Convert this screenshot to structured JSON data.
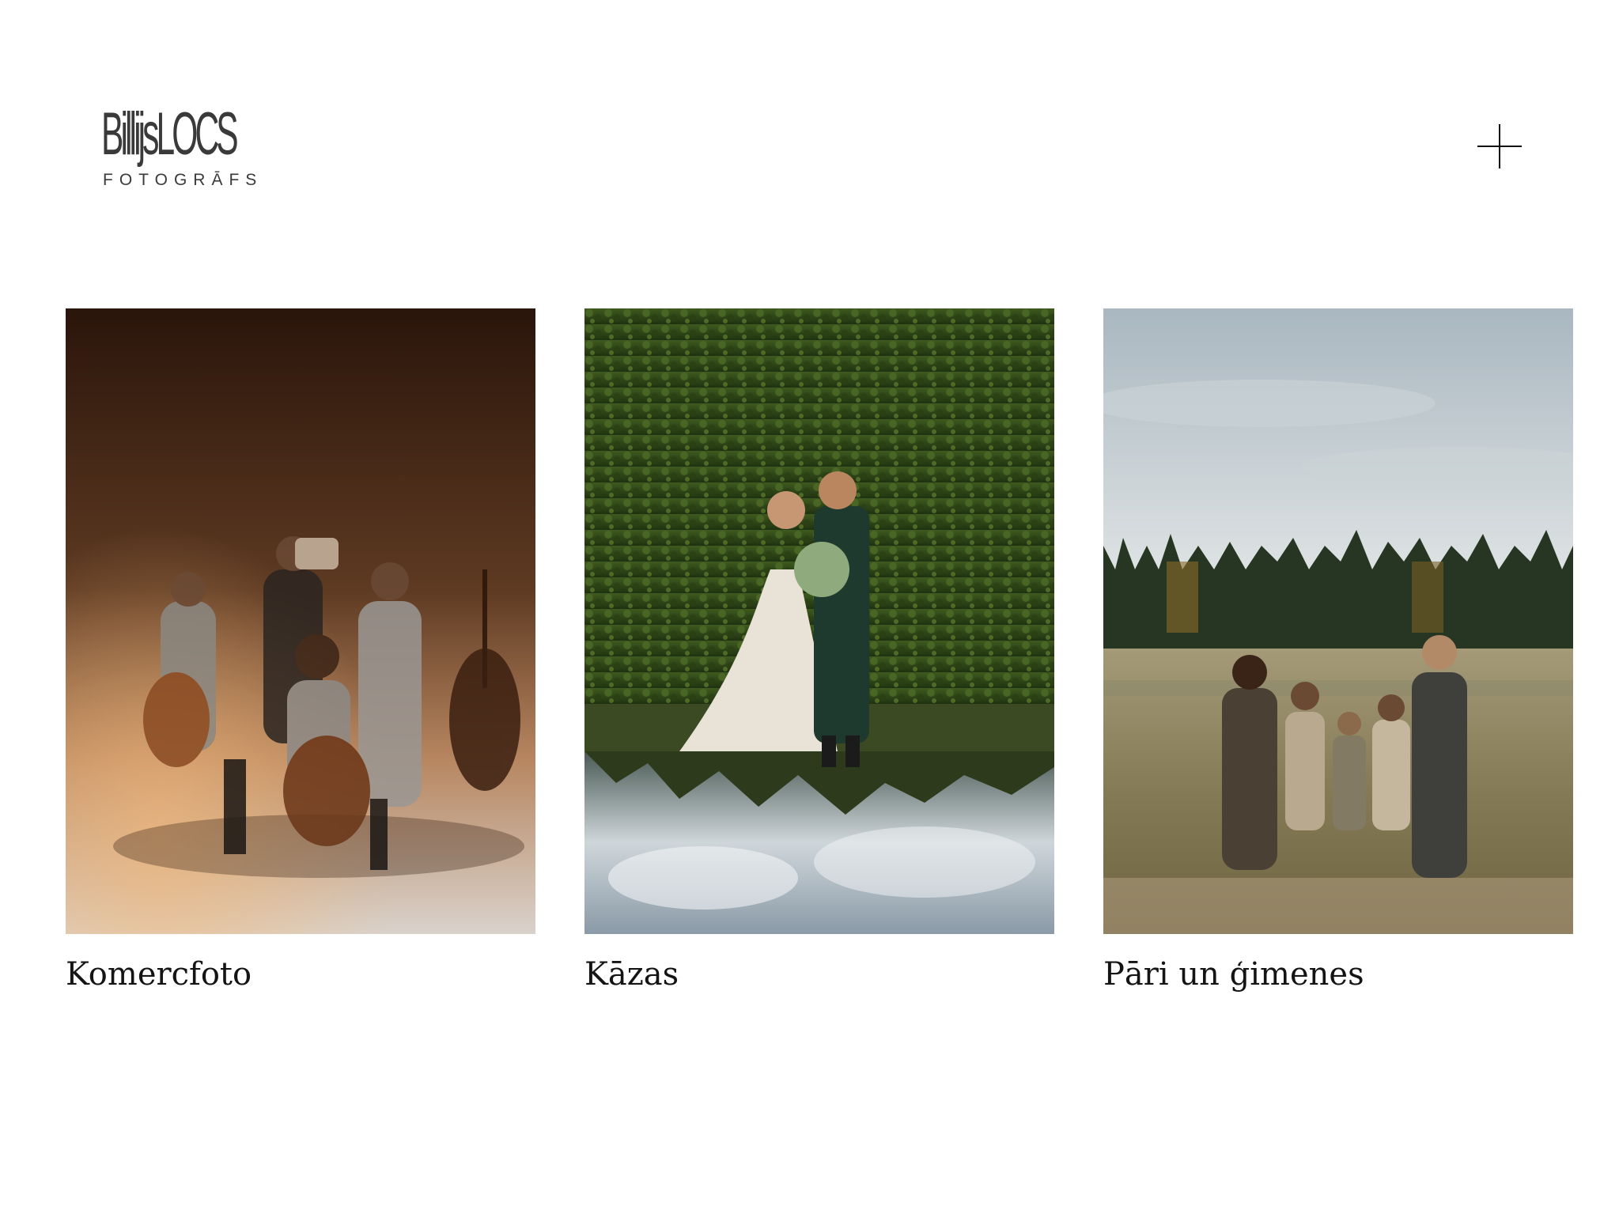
{
  "header": {
    "logo": {
      "name": "BillijsLOCS",
      "subtitle": "FOTOGRĀFS"
    },
    "menu_icon": "plus-icon"
  },
  "gallery": {
    "items": [
      {
        "label": "Komercfoto",
        "photo": "band-with-cellos-photo"
      },
      {
        "label": "Kāzas",
        "photo": "wedding-couple-photo"
      },
      {
        "label": "Pāri un ģimenes",
        "photo": "family-in-field-photo"
      }
    ]
  },
  "colors": {
    "background": "#ffffff",
    "text": "#141414",
    "logo": "#3a3a3a"
  }
}
